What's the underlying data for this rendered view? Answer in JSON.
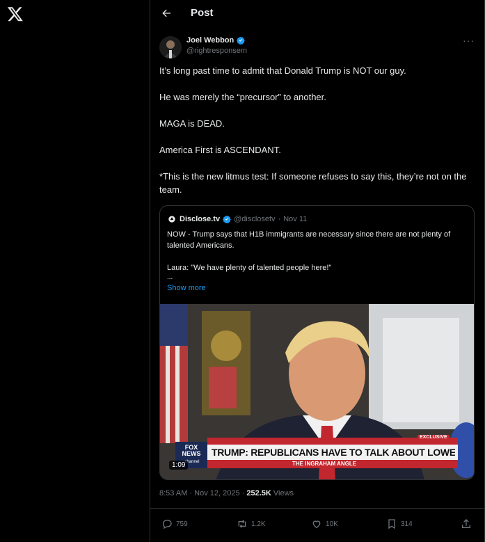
{
  "header": {
    "title": "Post"
  },
  "author": {
    "name": "Joel Webbon",
    "handle": "@rightresponsem"
  },
  "tweet": {
    "paragraphs": [
      "It’s long past time to admit that Donald Trump is NOT our guy.",
      "He was merely the “precursor” to another.",
      "MAGA is DEAD.",
      "America First is ASCENDANT.",
      "*This is the new litmus test: If someone refuses to say this, they’re not on the team."
    ]
  },
  "quote": {
    "name": "Disclose.tv",
    "handle": "@disclosetv",
    "separator": "·",
    "date": "Nov 11",
    "paragraphs": [
      "NOW - Trump says that H1B immigrants are necessary since there are not plenty of talented Americans.",
      "Laura: \"We have plenty of talented people here!\""
    ],
    "ellipsis": "...",
    "show_more": "Show more",
    "video": {
      "duration": "1:09",
      "badge": "EXCLUSIVE",
      "chyron": "TRUMP: REPUBLICANS HAVE TO TALK ABOUT LOWER PRICES",
      "network": "FOX NEWS",
      "network_sub": "channel",
      "show": "THE INGRAHAM ANGLE"
    }
  },
  "meta": {
    "time": "8:53 AM · Nov 12, 2025 ·",
    "views": "252.5K",
    "views_label": "Views"
  },
  "actions": {
    "replies": "759",
    "reposts": "1.2K",
    "likes": "10K",
    "bookmarks": "314"
  },
  "colors": {
    "accent": "#1d9bf0",
    "muted": "#71767b",
    "border": "#2f3336"
  }
}
